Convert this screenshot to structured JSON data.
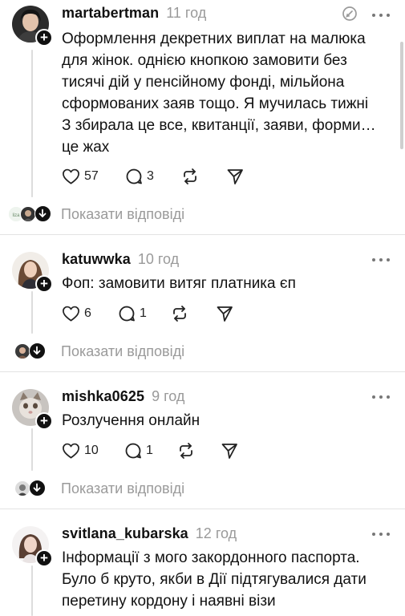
{
  "posts": [
    {
      "username": "martabertman",
      "time": "11 год",
      "text_lines": [
        "Оформлення декретних виплат на малюка",
        "для жінок. однією кнопкою замовити без",
        "тисячі дій у пенсійному фонді, мільйона",
        "сформованих заяв тощо. Я мучилась тижні",
        "З збирала це все, квитанції, заяви, форми…",
        "це жах"
      ],
      "likes": "57",
      "comments": "3",
      "show_replies": "Показати відповіді"
    },
    {
      "username": "katuwwka",
      "time": "10 год",
      "text_lines": [
        "Фоп: замовити витяг платника єп"
      ],
      "likes": "6",
      "comments": "1",
      "show_replies": "Показати відповіді"
    },
    {
      "username": "mishka0625",
      "time": "9 год",
      "text_lines": [
        "Розлучення онлайн"
      ],
      "likes": "10",
      "comments": "1",
      "show_replies": "Показати відповіді"
    },
    {
      "username": "svitlana_kubarska",
      "time": "12 год",
      "text_lines": [
        "Інформації з мого закордонного паспорта.",
        "Було б круто, якби в Дії підтягувалися дати",
        "перетину кордону і наявні візи"
      ]
    }
  ],
  "icons": {
    "like": "heart-icon",
    "comment": "comment-icon",
    "repost": "repost-icon",
    "share": "send-icon",
    "more": "more-icon",
    "follow": "plus-icon",
    "expand": "arrow-down-icon",
    "edited": "edit-icon"
  },
  "colors": {
    "text": "#111111",
    "muted": "#9a9a9a",
    "divider": "#e3e3e3",
    "thread_line": "#dcdcdc"
  }
}
